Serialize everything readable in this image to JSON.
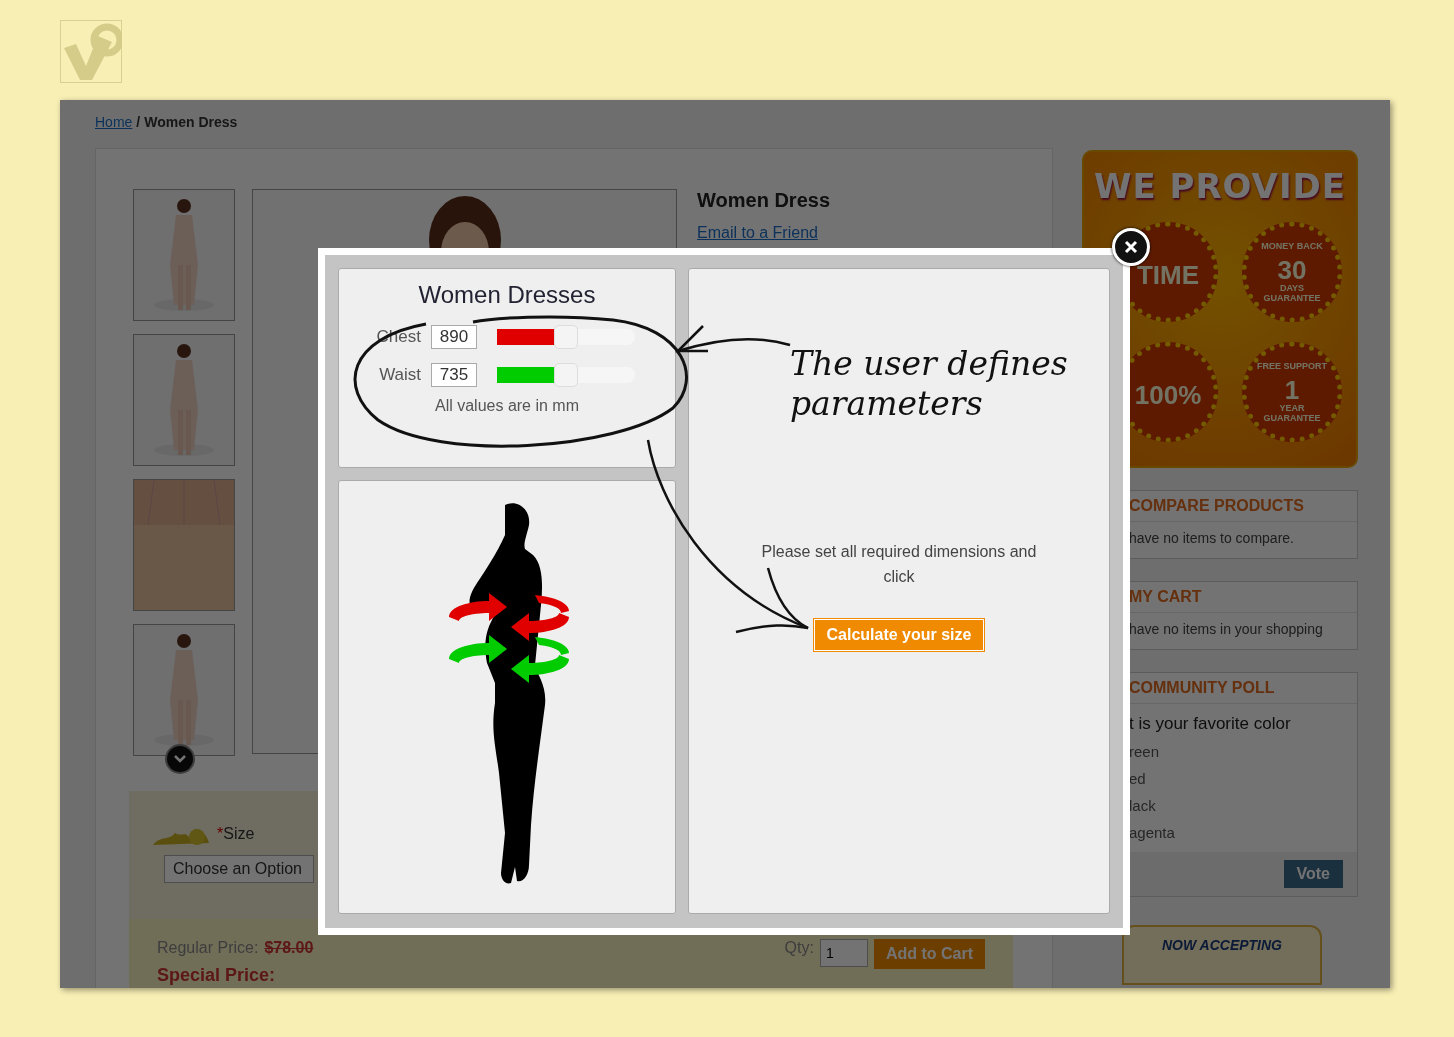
{
  "breadcrumb": {
    "items": [
      {
        "label": "Home",
        "link": true
      },
      {
        "label": "Women Dress",
        "link": false
      }
    ],
    "separator": "/"
  },
  "product": {
    "title": "Women Dress",
    "email_link": "Email to a Friend"
  },
  "options": {
    "required_mark": "*",
    "label": "Size",
    "select": "Choose an Option"
  },
  "price": {
    "regular_label": "Regular Price:",
    "regular_value": "$78.00",
    "special_label": "Special Price:",
    "qty_label": "Qty:",
    "qty": "1",
    "add_button": "Add to Cart"
  },
  "sidebar": {
    "banner": {
      "title": "WE PROVIDE",
      "badges": [
        {
          "main": "TIME"
        },
        {
          "top": "MONEY BACK",
          "main": "30",
          "sub": "DAYS",
          "bottom": "GUARANTEE"
        },
        {
          "main": "100%"
        },
        {
          "top": "FREE SUPPORT",
          "main": "1",
          "sub": "YEAR",
          "bottom": "GUARANTEE"
        }
      ]
    },
    "blocks": [
      {
        "title": "COMPARE PRODUCTS",
        "text": "have no items to compare."
      },
      {
        "title": "MY CART",
        "text": "have no items in your shopping"
      }
    ],
    "poll": {
      "title": "COMMUNITY POLL",
      "question": "t is your favorite color",
      "options": [
        "reen",
        "ed",
        "lack",
        "agenta"
      ],
      "button": "Vote"
    },
    "paypal": {
      "text": "NOW ACCEPTING"
    }
  },
  "modal": {
    "title": "Women Dresses",
    "measures": [
      {
        "label": "Chest",
        "value": "890",
        "level": 0.5,
        "color": "#e00000"
      },
      {
        "label": "Waist",
        "value": "735",
        "level": 0.5,
        "color": "#00cc00"
      }
    ],
    "units_note": "All values are in mm",
    "message": "Please set all required dimensions and click",
    "button": "Calculate your size",
    "annotation": "The user defines parameters"
  }
}
